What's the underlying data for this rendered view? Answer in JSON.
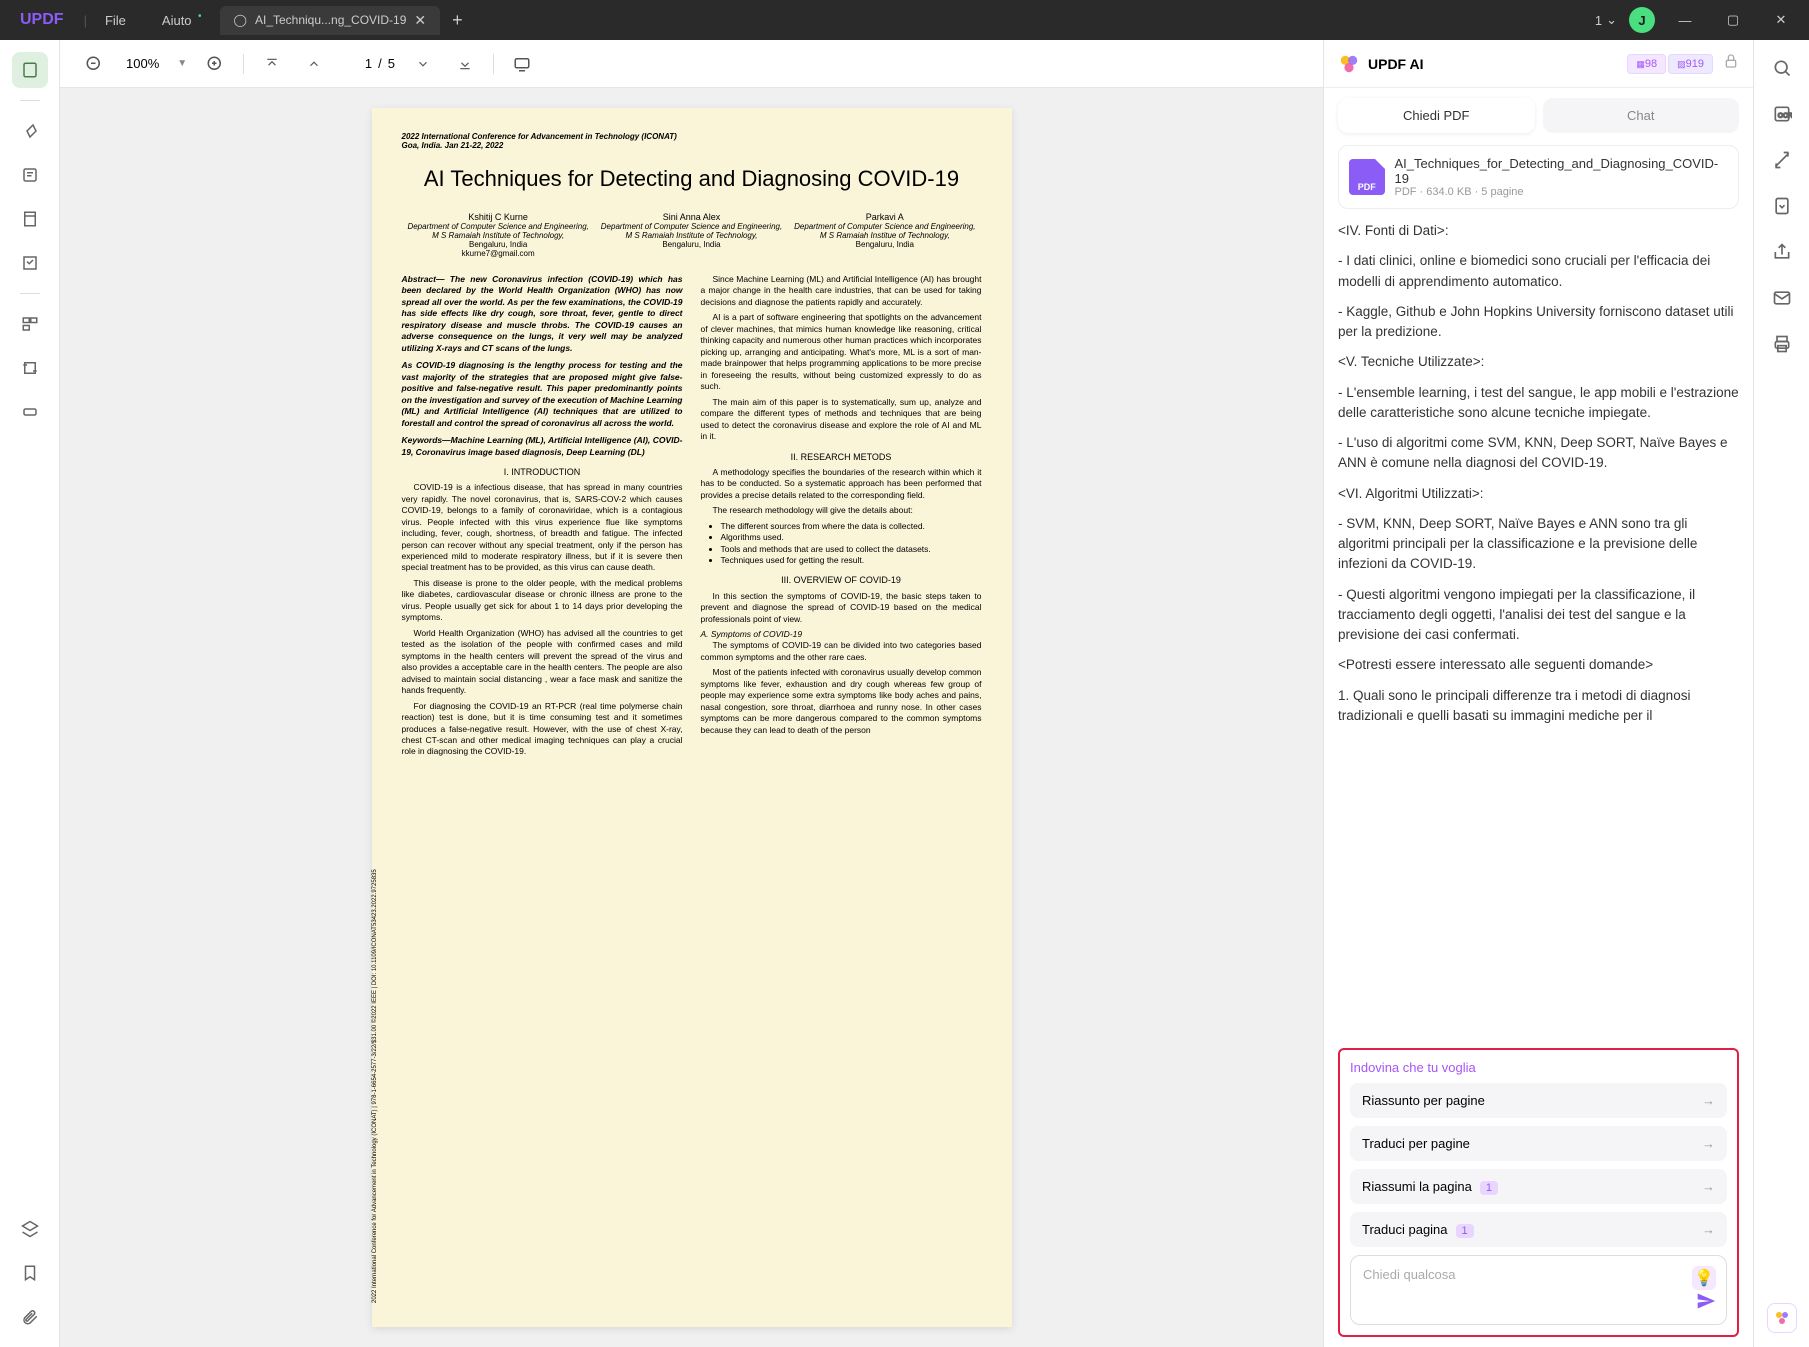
{
  "titlebar": {
    "logo": "UPDF",
    "menu": [
      "File",
      "Aiuto"
    ],
    "tab": {
      "title": "AI_Techniqu...ng_COVID-19"
    },
    "page_indicator": "1",
    "user_initial": "J"
  },
  "toolbar": {
    "zoom": "100%",
    "page_current": "1",
    "page_total": "5"
  },
  "document": {
    "conference": "2022 International Conference for Advancement in Technology (ICONAT)",
    "location": "Goa, India. Jan 21-22, 2022",
    "title": "AI Techniques for Detecting and Diagnosing COVID-19",
    "authors": [
      {
        "name": "Kshitij C Kurne",
        "dept": "Department of Computer Science and Engineering,",
        "inst": "M S Ramaiah Institute of Technology,",
        "city": "Bengaluru, India",
        "email": "kkurne7@gmail.com"
      },
      {
        "name": "Sini Anna Alex",
        "dept": "Department of Computer Science and Engineering,",
        "inst": "M S Ramaiah Institute of Technology,",
        "city": "Bengaluru, India",
        "email": ""
      },
      {
        "name": "Parkavi A",
        "dept": "Department of Computer Science and Engineering,",
        "inst": "M S Ramaiah Institue of Technology,",
        "city": "Bengaluru, India",
        "email": ""
      }
    ],
    "side_text": "2022 International Conference for Advancement in Technology (ICONAT) | 978-1-6654-2577-3/22/$31.00 ©2022 IEEE | DOI: 10.1109/ICONAT53423.2022.9725835",
    "col1": {
      "abstract": "Abstract— The new Coronavirus infection (COVID-19) which has been declared by the World Health Organization (WHO) has now spread all over the world. As per the few examinations, the COVID-19 has side effects like dry cough, sore throat, fever, gentle to direct respiratory disease and muscle throbs. The COVID-19 causes an adverse consequence on the lungs, it very well may be analyzed utilizing X-rays and CT scans of the lungs.",
      "p2": "As COVID-19 diagnosing is the lengthy process for testing and the vast majority of the strategies that are proposed might give false-positive and false-negative result. This paper predominantly points on the investigation and survey of the execution of Machine Learning (ML) and Artificial Intelligence (AI) techniques that are utilized to forestall and control the spread of coronavirus all across the world.",
      "keywords": "Keywords—Machine Learning (ML), Artificial Intelligence (AI), COVID-19, Coronavirus image based diagnosis, Deep Learning (DL)",
      "s1_head": "I.     INTRODUCTION",
      "s1_p1": "COVID-19 is a infectious disease, that has spread in many countries very rapidly. The novel coronavirus, that is, SARS-COV-2 which causes COVID-19, belongs to a family of coronaviridae, which is a contagious virus. People infected with this virus experience flue like symptoms including, fever, cough, shortness, of breadth and fatigue. The infected person can recover without any special treatment, only if the person has experienced mild to moderate respiratory illness, but if it is severe then special treatment has to be provided, as this virus can cause death.",
      "s1_p2": "This disease is prone to the older people, with the medical problems like diabetes, cardiovascular disease or chronic illness are prone to the virus. People usually get sick for about 1 to 14 days prior developing the symptoms.",
      "s1_p3": "World Health Organization (WHO) has advised all the countries to get tested as the isolation of the people with confirmed cases and mild symptoms in the health centers will prevent the spread of the virus and also provides a acceptable care in the health centers. The people are also advised to maintain social distancing , wear a face mask and sanitize the hands frequently.",
      "s1_p4": "For diagnosing the COVID-19 an RT-PCR (real time polymerse chain reaction) test is done, but it is time consuming test and it sometimes produces a false-negative result. However, with the use of chest X-ray, chest CT-scan and other medical imaging techniques can play a crucial role in diagnosing the COVID-19."
    },
    "col2": {
      "p1": "Since Machine Learning (ML) and Artificial Intelligence (AI) has brought a major change in the health care industries, that can be used for taking decisions and diagnose the patients rapidly and accurately.",
      "p2": "AI is a part of software engineering that spotlights on the advancement of clever machines, that mimics human knowledge like reasoning, critical thinking capacity and numerous other human practices which incorporates picking up, arranging and anticipating. What's more, ML is a sort of man-made brainpower that helps programming applications to be more precise in foreseeing the results, without being customized expressly to do as such.",
      "p3": "The main aim of this paper is to systematically, sum up, analyze and compare the different types of methods and techniques that are being used to detect the coronavirus disease and explore the role of AI and ML in it.",
      "s2_head": "II.     RESEARCH METODS",
      "s2_p1": "A methodology specifies the boundaries of the research within which it has to be conducted. So a systematic approach has been performed that provides a precise details related to the corresponding field.",
      "s2_p2": "The research methodology will give the details about:",
      "bullets": [
        "The different sources from where the data is collected.",
        "Algorithms used.",
        "Tools and methods that are used to collect the datasets.",
        "Techniques used for getting the result."
      ],
      "s3_head": "III.     OVERVIEW OF COVID-19",
      "s3_p1": "In this section the symptoms of COVID-19, the basic steps taken to prevent and diagnose the spread of COVID-19 based on the medical professionals point of view.",
      "s3_sub": "A. Symptoms of COVID-19",
      "s3_p2": "The symptoms of COVID-19 can be divided into two categories based common symptoms and the other rare caes.",
      "s3_p3": "Most of the patients infected with coronavirus usually develop common symptoms like fever, exhaustion and dry cough whereas few group of people may experience some extra symptoms like body aches and pains, nasal congestion, sore throat, diarrhoea and runny nose. In other cases symptoms can be more dangerous compared to the common symptoms because they can lead to death of the person"
    }
  },
  "ai": {
    "title": "UPDF AI",
    "credits": {
      "a": "98",
      "b": "919"
    },
    "tabs": {
      "active": "Chiedi PDF",
      "inactive": "Chat"
    },
    "file": {
      "name": "AI_Techniques_for_Detecting_and_Diagnosing_COVID-19",
      "meta": "PDF · 634.0 KB · 5 pagine",
      "icon_label": "PDF"
    },
    "messages": [
      "<IV. Fonti di Dati>:",
      "- I dati clinici, online e biomedici sono cruciali per l'efficacia dei modelli di apprendimento automatico.",
      "- Kaggle, Github e John Hopkins University forniscono dataset utili per la predizione.",
      "",
      "<V. Tecniche Utilizzate>:",
      "- L'ensemble learning, i test del sangue, le app mobili e l'estrazione delle caratteristiche sono alcune tecniche impiegate.",
      "- L'uso di algoritmi come SVM, KNN, Deep SORT, Naïve Bayes e ANN è comune nella diagnosi del COVID-19.",
      "",
      "<VI. Algoritmi Utilizzati>:",
      "- SVM, KNN, Deep SORT, Naïve Bayes e ANN sono tra gli algoritmi principali per la classificazione e la previsione delle infezioni da COVID-19.",
      "- Questi algoritmi vengono impiegati per la classificazione, il tracciamento degli oggetti, l'analisi dei test del sangue e la previsione dei casi confermati.",
      "",
      "<Potresti essere interessato alle seguenti domande>",
      "1. Quali sono le principali differenze tra i metodi di diagnosi tradizionali e quelli basati su immagini mediche per il"
    ],
    "suggest": {
      "title": "Indovina che tu voglia",
      "items": [
        {
          "label": "Riassunto per pagine",
          "badge": ""
        },
        {
          "label": "Traduci per pagine",
          "badge": ""
        },
        {
          "label": "Riassumi la pagina",
          "badge": "1"
        },
        {
          "label": "Traduci pagina",
          "badge": "1"
        }
      ]
    },
    "input_placeholder": "Chiedi qualcosa"
  }
}
